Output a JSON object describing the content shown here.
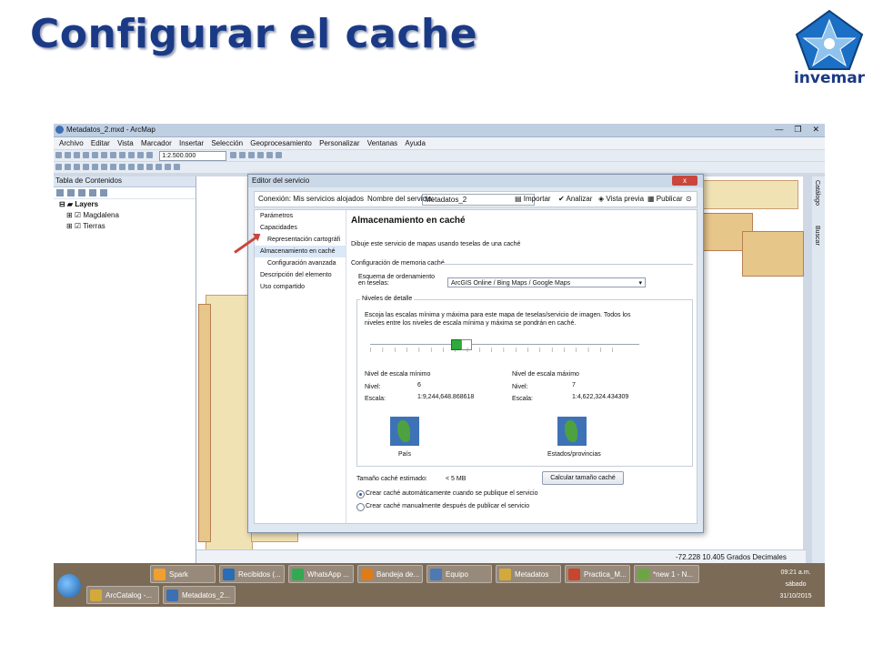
{
  "slide": {
    "title": "Configurar el cache",
    "logo_text": "invemar"
  },
  "window": {
    "title": "Metadatos_2.mxd - ArcMap",
    "controls": [
      "—",
      "❐",
      "✕"
    ]
  },
  "menu": [
    "Archivo",
    "Editar",
    "Vista",
    "Marcador",
    "Insertar",
    "Selección",
    "Geoprocesamiento",
    "Personalizar",
    "Ventanas",
    "Ayuda"
  ],
  "toolbar": {
    "scale_value": "1:2.500.000"
  },
  "toc": {
    "header": "Tabla de Contenidos",
    "items": [
      {
        "label": "Layers",
        "bold": true
      },
      {
        "label": "Magdalena"
      },
      {
        "label": "Tierras"
      }
    ]
  },
  "right_panel": {
    "tabs": [
      "Catálogo",
      "Buscar"
    ]
  },
  "status": {
    "coords": "-72.228  10.405 Grados Decimales"
  },
  "dialog": {
    "title": "Editor del servicio",
    "close": "x",
    "connection": "Conexión: Mis servicios alojados",
    "service_label": "Nombre del servicio:",
    "service_name": "Metadatos_2",
    "actions": [
      "Importar",
      "Analizar",
      "Vista previa",
      "Publicar"
    ],
    "nav": [
      {
        "label": "Parámetros",
        "sub": false
      },
      {
        "label": "Capacidades",
        "sub": false
      },
      {
        "label": "Representación cartográfi",
        "sub": true
      },
      {
        "label": "Almacenamiento en caché",
        "sub": false,
        "selected": true
      },
      {
        "label": "Configuración avanzada",
        "sub": true
      },
      {
        "label": "Descripción del elemento",
        "sub": false
      },
      {
        "label": "Uso compartido",
        "sub": false
      }
    ],
    "pane": {
      "heading": "Almacenamiento en caché",
      "intro": "Dibuje este servicio de mapas usando teselas de una caché",
      "config_label": "Configuración de memoria caché",
      "scheme_label": "Esquema de ordenamiento en teselas:",
      "scheme_value": "ArcGIS Online / Bing Maps / Google Maps",
      "levels_label": "Niveles de detalle",
      "levels_desc": "Escoja las escalas mínima y máxima para este mapa de teselas/servicio de imagen. Todos los niveles entre los niveles de escala mínima y máxima se pondrán en caché.",
      "min": {
        "title": "Nivel de escala mínimo",
        "level_label": "Nivel:",
        "level": "6",
        "scale_label": "Escala:",
        "scale": "1:9,244,648.868618",
        "caption": "País"
      },
      "max": {
        "title": "Nivel de escala máximo",
        "level_label": "Nivel:",
        "level": "7",
        "scale_label": "Escala:",
        "scale": "1:4,622,324.434309",
        "caption": "Estados/provincias"
      },
      "size_label": "Tamaño caché estimado:",
      "size_value": "< 5 MB",
      "calc_button": "Calcular tamaño caché",
      "radio_auto": "Crear caché automáticamente cuando se publique el servicio",
      "radio_manual": "Crear caché manualmente después de publicar el servicio"
    }
  },
  "taskbar": {
    "top_row": [
      {
        "label": "Spark",
        "color": "#f0a030"
      },
      {
        "label": "Recibidos (...",
        "color": "#2a6db5"
      },
      {
        "label": "WhatsApp ...",
        "color": "#34a853"
      },
      {
        "label": "Bandeja de...",
        "color": "#e07b1a"
      },
      {
        "label": "Equipo",
        "color": "#4d79b5"
      },
      {
        "label": "Metadatos",
        "color": "#d4a93c"
      },
      {
        "label": "Practica_M...",
        "color": "#c8452e"
      },
      {
        "label": "*new 1 - N...",
        "color": "#6da544"
      }
    ],
    "bottom_row": [
      {
        "label": "ArcCatalog -...",
        "color": "#d4a93c"
      },
      {
        "label": "Metadatos_2...",
        "color": "#3d6fb3"
      }
    ],
    "clock": {
      "time": "09:21 a.m.",
      "day": "sábado",
      "date": "31/10/2015"
    }
  }
}
